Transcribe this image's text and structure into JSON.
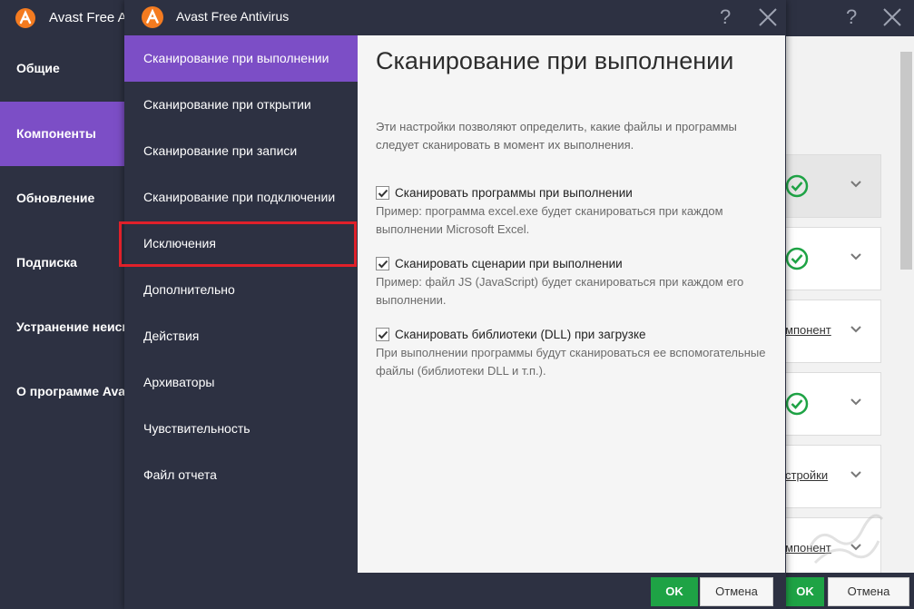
{
  "colors": {
    "sidebar_bg": "#2d3142",
    "accent_purple": "#7c4ec6",
    "ok_green": "#1ea345",
    "highlight_red": "#e0202a",
    "check_green": "#1ea345",
    "panel_bg": "#f5f5f5"
  },
  "background_window": {
    "title": "Avast Free A",
    "help_icon": "?",
    "nav": [
      {
        "label": "Общие"
      },
      {
        "label": "Компоненты",
        "active": true
      },
      {
        "label": "Обновление"
      },
      {
        "label": "Подписка"
      },
      {
        "label": "Устранение неисп"
      },
      {
        "label": "О программе Ava"
      }
    ],
    "cards": [
      {
        "type": "check"
      },
      {
        "type": "check"
      },
      {
        "type": "link",
        "text": "мпонент"
      },
      {
        "type": "check"
      },
      {
        "type": "link",
        "text": "стройки"
      },
      {
        "type": "link",
        "text": "мпонент"
      }
    ],
    "footer": {
      "ok_label": "OK",
      "cancel_label": "Отмена"
    }
  },
  "dialog": {
    "title": "Avast Free Antivirus",
    "help_icon": "?",
    "menu": [
      {
        "label": "Сканирование при выполнении",
        "active": true
      },
      {
        "label": "Сканирование при открытии"
      },
      {
        "label": "Сканирование при записи"
      },
      {
        "label": "Сканирование при подключении"
      },
      {
        "label": "Исключения",
        "highlighted": true
      },
      {
        "label": "Дополнительно"
      },
      {
        "label": "Действия"
      },
      {
        "label": "Архиваторы"
      },
      {
        "label": "Чувствительность"
      },
      {
        "label": "Файл отчета"
      }
    ],
    "panel": {
      "title": "Сканирование при выполнении",
      "description": "Эти настройки позволяют определить, какие файлы и программы следует сканировать в момент их выполнения.",
      "options": [
        {
          "label": "Сканировать программы при выполнении",
          "checked": true,
          "help": "Пример: программа excel.exe будет сканироваться при каждом выполнении Microsoft Excel."
        },
        {
          "label": "Сканировать сценарии при выполнении",
          "checked": true,
          "help": "Пример: файл JS (JavaScript) будет сканироваться при каждом его выполнении."
        },
        {
          "label": "Сканировать библиотеки (DLL) при загрузке",
          "checked": true,
          "help": "При выполнении программы будут сканироваться ее вспомогательные файлы (библиотеки DLL и т.п.)."
        }
      ]
    },
    "footer": {
      "ok_label": "OK",
      "cancel_label": "Отмена"
    }
  }
}
